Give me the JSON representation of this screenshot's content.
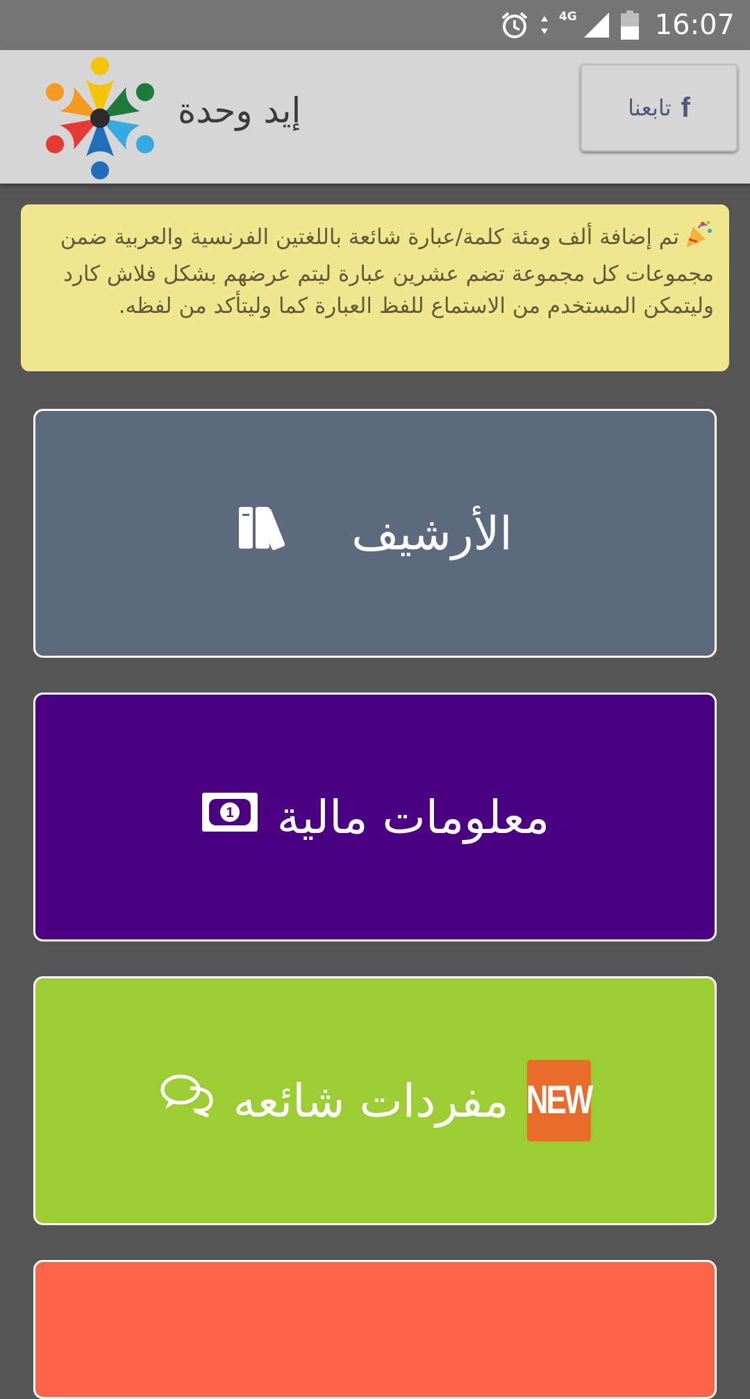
{
  "status_bar": {
    "time": "16:07",
    "network": "4G",
    "icons": [
      "alarm-icon",
      "data-arrows-icon",
      "signal-icon",
      "battery-icon"
    ]
  },
  "header": {
    "app_title": "إيد وحدة",
    "follow_label": "تابعنا",
    "follow_icon": "facebook-icon",
    "logo_icon": "people-circle-logo"
  },
  "notice": {
    "icon": "party-popper-icon",
    "text": "تم إضافة ألف ومئة كلمة/عبارة شائعة باللغتين الفرنسية والعربية ضمن مجموعات كل مجموعة تضم عشرين عبارة ليتم عرضهم بشكل فلاش كارد وليتمكن المستخدم من الاستماع للفظ العبارة كما وليتأكد من لفظه."
  },
  "cards": [
    {
      "label": "الأرشيف",
      "icon": "books-icon",
      "color": "#5d6a7e"
    },
    {
      "label": "معلومات مالية",
      "icon": "money-bill-icon",
      "color": "#4a0080"
    },
    {
      "label": "مفردات شائعه",
      "icon": "comments-icon",
      "badge": "NEW",
      "color": "#9ccd32"
    },
    {
      "label": "",
      "color": "#ff6347"
    }
  ]
}
